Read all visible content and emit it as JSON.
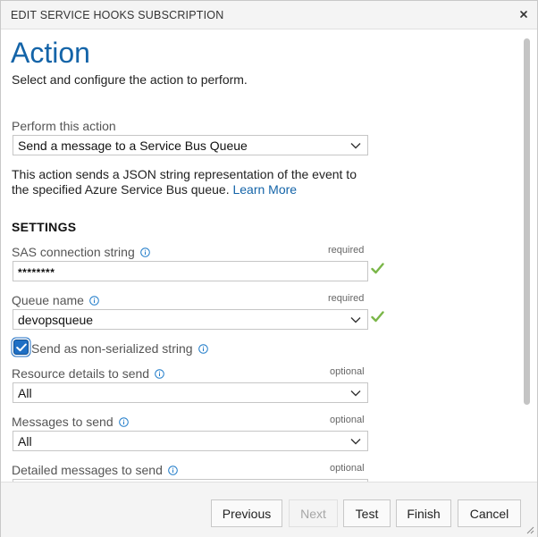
{
  "dialog": {
    "title": "EDIT SERVICE HOOKS SUBSCRIPTION"
  },
  "page": {
    "heading": "Action",
    "subheading": "Select and configure the action to perform."
  },
  "action": {
    "label": "Perform this action",
    "value": "Send a message to a Service Bus Queue",
    "description": "This action sends a JSON string representation of the event to the specified Azure Service Bus queue.",
    "learn_more": "Learn More"
  },
  "settings": {
    "title": "SETTINGS",
    "sas": {
      "label": "SAS connection string",
      "requirement": "required",
      "value": "********"
    },
    "queue": {
      "label": "Queue name",
      "requirement": "required",
      "value": "devopsqueue"
    },
    "non_serialized": {
      "label": "Send as non-serialized string",
      "checked": true
    },
    "resource_details": {
      "label": "Resource details to send",
      "requirement": "optional",
      "value": "All"
    },
    "messages": {
      "label": "Messages to send",
      "requirement": "optional",
      "value": "All"
    },
    "detailed_messages": {
      "label": "Detailed messages to send",
      "requirement": "optional"
    }
  },
  "footer": {
    "previous": "Previous",
    "next": "Next",
    "test": "Test",
    "finish": "Finish",
    "cancel": "Cancel"
  },
  "colors": {
    "accent": "#1464a8",
    "checkbox": "#1f6fc4",
    "success": "#7ab648"
  }
}
